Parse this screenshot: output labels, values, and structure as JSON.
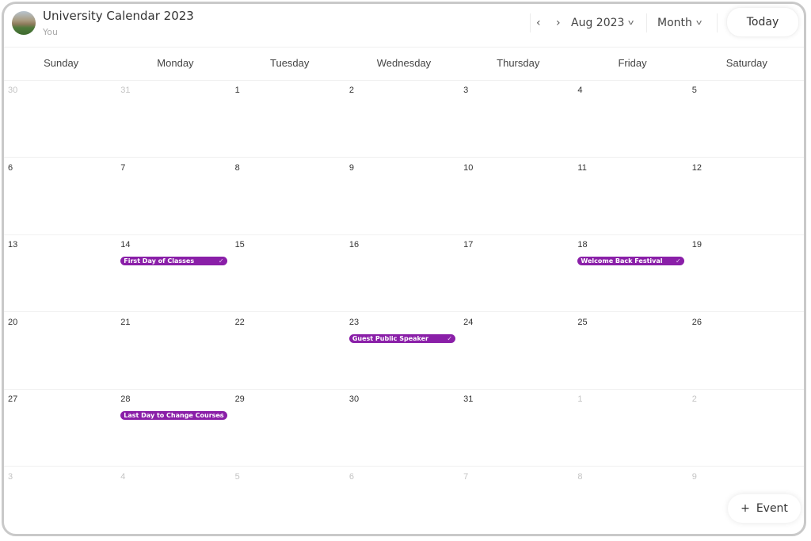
{
  "header": {
    "title": "University Calendar 2023",
    "subtitle": "You",
    "prev_icon": "‹",
    "next_icon": "›",
    "period_label": "Aug 2023",
    "view_label": "Month",
    "chevron": "v",
    "today_label": "Today"
  },
  "weekdays": [
    "Sunday",
    "Monday",
    "Tuesday",
    "Wednesday",
    "Thursday",
    "Friday",
    "Saturday"
  ],
  "weeks": [
    [
      {
        "d": "30",
        "m": true
      },
      {
        "d": "31",
        "m": true
      },
      {
        "d": "1"
      },
      {
        "d": "2"
      },
      {
        "d": "3"
      },
      {
        "d": "4"
      },
      {
        "d": "5"
      }
    ],
    [
      {
        "d": "6"
      },
      {
        "d": "7"
      },
      {
        "d": "8"
      },
      {
        "d": "9"
      },
      {
        "d": "10"
      },
      {
        "d": "11"
      },
      {
        "d": "12"
      }
    ],
    [
      {
        "d": "13"
      },
      {
        "d": "14",
        "event": "First Day of Classes"
      },
      {
        "d": "15"
      },
      {
        "d": "16"
      },
      {
        "d": "17"
      },
      {
        "d": "18",
        "event": "Welcome Back Festival"
      },
      {
        "d": "19"
      }
    ],
    [
      {
        "d": "20"
      },
      {
        "d": "21"
      },
      {
        "d": "22"
      },
      {
        "d": "23",
        "event": "Guest Public Speaker"
      },
      {
        "d": "24"
      },
      {
        "d": "25"
      },
      {
        "d": "26"
      }
    ],
    [
      {
        "d": "27"
      },
      {
        "d": "28",
        "event": "Last Day to Change Courses"
      },
      {
        "d": "29"
      },
      {
        "d": "30"
      },
      {
        "d": "31"
      },
      {
        "d": "1",
        "m": true
      },
      {
        "d": "2",
        "m": true
      }
    ],
    [
      {
        "d": "3",
        "m": true
      },
      {
        "d": "4",
        "m": true
      },
      {
        "d": "5",
        "m": true
      },
      {
        "d": "6",
        "m": true
      },
      {
        "d": "7",
        "m": true
      },
      {
        "d": "8",
        "m": true
      },
      {
        "d": "9",
        "m": true
      }
    ]
  ],
  "event_check": "✓",
  "event_color": "#8a1fa8",
  "add_event": {
    "icon": "+",
    "label": "Event"
  }
}
